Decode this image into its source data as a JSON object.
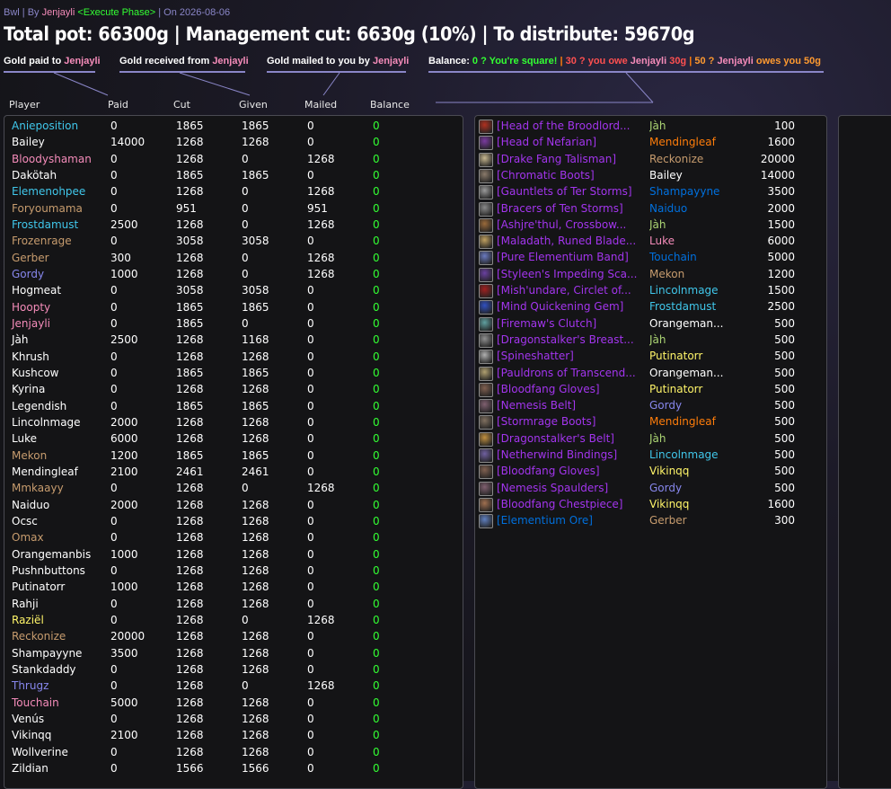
{
  "colors": {
    "druid": "#ff7d0a",
    "hunter": "#abd473",
    "mage": "#40c7eb",
    "paladin": "#f58cba",
    "priest": "#ffffff",
    "rogue": "#fff569",
    "shaman": "#0070de",
    "warlock": "#8787ed",
    "warrior": "#c79c6e",
    "epic": "#a335ee",
    "rare": "#0070dd",
    "zero": "#33ff33",
    "muted": "#8a86c8"
  },
  "topbar": {
    "raid": "Bwl",
    "sep1": " | By ",
    "author": "Jenjayli",
    "phase": " <Execute Phase>",
    "sep2": " | On 2026-08-06"
  },
  "title": "Total pot: 66300g | Management cut: 6630g (10%) | To distribute: 59670g",
  "legend": {
    "paid_prefix": "Gold paid to ",
    "paid_name": "Jenjayli",
    "received_prefix": "Gold received from ",
    "received_name": "Jenjayli",
    "mailed_prefix": "Gold mailed to you by ",
    "mailed_name": "Jenjayli",
    "balance_label": "Balance: ",
    "bal_zero": "0 ? You're square!",
    "bal_sep1": " | ",
    "bal_neg_prefix": "30 ? you owe ",
    "bal_neg_name": "Jenjayli",
    "bal_neg_suffix": " 30g",
    "bal_sep2": " | ",
    "bal_pos_prefix": "50 ? ",
    "bal_pos_name": "Jenjayli",
    "bal_pos_suffix": " owes you 50g"
  },
  "columns": {
    "player": "Player",
    "paid": "Paid",
    "cut": "Cut",
    "given": "Given",
    "mailed": "Mailed",
    "balance": "Balance"
  },
  "players": [
    {
      "name": "Anieposition",
      "cls": "mage",
      "paid": "0",
      "cut": "1865",
      "given": "1865",
      "mailed": "0",
      "balance": "0"
    },
    {
      "name": "Bailey",
      "cls": "priest",
      "paid": "14000",
      "cut": "1268",
      "given": "1268",
      "mailed": "0",
      "balance": "0"
    },
    {
      "name": "Bloodyshaman",
      "cls": "paladin",
      "paid": "0",
      "cut": "1268",
      "given": "0",
      "mailed": "1268",
      "balance": "0"
    },
    {
      "name": "Dakötah",
      "cls": "priest",
      "paid": "0",
      "cut": "1865",
      "given": "1865",
      "mailed": "0",
      "balance": "0"
    },
    {
      "name": "Elemenohpee",
      "cls": "mage",
      "paid": "0",
      "cut": "1268",
      "given": "0",
      "mailed": "1268",
      "balance": "0"
    },
    {
      "name": "Foryoumama",
      "cls": "warrior",
      "paid": "0",
      "cut": "951",
      "given": "0",
      "mailed": "951",
      "balance": "0"
    },
    {
      "name": "Frostdamust",
      "cls": "mage",
      "paid": "2500",
      "cut": "1268",
      "given": "0",
      "mailed": "1268",
      "balance": "0"
    },
    {
      "name": "Frozenrage",
      "cls": "warrior",
      "paid": "0",
      "cut": "3058",
      "given": "3058",
      "mailed": "0",
      "balance": "0"
    },
    {
      "name": "Gerber",
      "cls": "warrior",
      "paid": "300",
      "cut": "1268",
      "given": "0",
      "mailed": "1268",
      "balance": "0"
    },
    {
      "name": "Gordy",
      "cls": "warlock",
      "paid": "1000",
      "cut": "1268",
      "given": "0",
      "mailed": "1268",
      "balance": "0"
    },
    {
      "name": "Hogmeat",
      "cls": "priest",
      "paid": "0",
      "cut": "3058",
      "given": "3058",
      "mailed": "0",
      "balance": "0"
    },
    {
      "name": "Hoopty",
      "cls": "paladin",
      "paid": "0",
      "cut": "1865",
      "given": "1865",
      "mailed": "0",
      "balance": "0"
    },
    {
      "name": "Jenjayli",
      "cls": "paladin",
      "paid": "0",
      "cut": "1865",
      "given": "0",
      "mailed": "0",
      "balance": "0"
    },
    {
      "name": "Jàh",
      "cls": "priest",
      "paid": "2500",
      "cut": "1268",
      "given": "1168",
      "mailed": "0",
      "balance": "0"
    },
    {
      "name": "Khrush",
      "cls": "priest",
      "paid": "0",
      "cut": "1268",
      "given": "1268",
      "mailed": "0",
      "balance": "0"
    },
    {
      "name": "Kushcow",
      "cls": "priest",
      "paid": "0",
      "cut": "1865",
      "given": "1865",
      "mailed": "0",
      "balance": "0"
    },
    {
      "name": "Kyrina",
      "cls": "priest",
      "paid": "0",
      "cut": "1268",
      "given": "1268",
      "mailed": "0",
      "balance": "0"
    },
    {
      "name": "Legendish",
      "cls": "priest",
      "paid": "0",
      "cut": "1865",
      "given": "1865",
      "mailed": "0",
      "balance": "0"
    },
    {
      "name": "Lincolnmage",
      "cls": "priest",
      "paid": "2000",
      "cut": "1268",
      "given": "1268",
      "mailed": "0",
      "balance": "0"
    },
    {
      "name": "Luke",
      "cls": "priest",
      "paid": "6000",
      "cut": "1268",
      "given": "1268",
      "mailed": "0",
      "balance": "0"
    },
    {
      "name": "Mekon",
      "cls": "warrior",
      "paid": "1200",
      "cut": "1865",
      "given": "1865",
      "mailed": "0",
      "balance": "0"
    },
    {
      "name": "Mendingleaf",
      "cls": "priest",
      "paid": "2100",
      "cut": "2461",
      "given": "2461",
      "mailed": "0",
      "balance": "0"
    },
    {
      "name": "Mmkaayy",
      "cls": "warrior",
      "paid": "0",
      "cut": "1268",
      "given": "0",
      "mailed": "1268",
      "balance": "0"
    },
    {
      "name": "Naiduo",
      "cls": "priest",
      "paid": "2000",
      "cut": "1268",
      "given": "1268",
      "mailed": "0",
      "balance": "0"
    },
    {
      "name": "Ocsc",
      "cls": "priest",
      "paid": "0",
      "cut": "1268",
      "given": "1268",
      "mailed": "0",
      "balance": "0"
    },
    {
      "name": "Omax",
      "cls": "warrior",
      "paid": "0",
      "cut": "1268",
      "given": "1268",
      "mailed": "0",
      "balance": "0"
    },
    {
      "name": "Orangemanbis",
      "cls": "priest",
      "paid": "1000",
      "cut": "1268",
      "given": "1268",
      "mailed": "0",
      "balance": "0"
    },
    {
      "name": "Pushnbuttons",
      "cls": "priest",
      "paid": "0",
      "cut": "1268",
      "given": "1268",
      "mailed": "0",
      "balance": "0"
    },
    {
      "name": "Putinatorr",
      "cls": "priest",
      "paid": "1000",
      "cut": "1268",
      "given": "1268",
      "mailed": "0",
      "balance": "0"
    },
    {
      "name": "Rahji",
      "cls": "priest",
      "paid": "0",
      "cut": "1268",
      "given": "1268",
      "mailed": "0",
      "balance": "0"
    },
    {
      "name": "Raziël",
      "cls": "rogue",
      "paid": "0",
      "cut": "1268",
      "given": "0",
      "mailed": "1268",
      "balance": "0"
    },
    {
      "name": "Reckonize",
      "cls": "warrior",
      "paid": "20000",
      "cut": "1268",
      "given": "1268",
      "mailed": "0",
      "balance": "0"
    },
    {
      "name": "Shampayyne",
      "cls": "priest",
      "paid": "3500",
      "cut": "1268",
      "given": "1268",
      "mailed": "0",
      "balance": "0"
    },
    {
      "name": "Stankdaddy",
      "cls": "priest",
      "paid": "0",
      "cut": "1268",
      "given": "1268",
      "mailed": "0",
      "balance": "0"
    },
    {
      "name": "Thrugz",
      "cls": "warlock",
      "paid": "0",
      "cut": "1268",
      "given": "0",
      "mailed": "1268",
      "balance": "0"
    },
    {
      "name": "Touchain",
      "cls": "paladin",
      "paid": "5000",
      "cut": "1268",
      "given": "1268",
      "mailed": "0",
      "balance": "0"
    },
    {
      "name": "Venús",
      "cls": "priest",
      "paid": "0",
      "cut": "1268",
      "given": "1268",
      "mailed": "0",
      "balance": "0"
    },
    {
      "name": "Vikinqq",
      "cls": "priest",
      "paid": "2100",
      "cut": "1268",
      "given": "1268",
      "mailed": "0",
      "balance": "0"
    },
    {
      "name": "Wollverine",
      "cls": "priest",
      "paid": "0",
      "cut": "1268",
      "given": "1268",
      "mailed": "0",
      "balance": "0"
    },
    {
      "name": "Zildian",
      "cls": "priest",
      "paid": "0",
      "cut": "1566",
      "given": "1566",
      "mailed": "0",
      "balance": "0"
    }
  ],
  "loot": [
    {
      "item": "[Head of the Broodlord...",
      "icon": "skull-icon",
      "icon_color": "#b03020",
      "looter": "Jàh",
      "cls": "hunter",
      "amount": "100"
    },
    {
      "item": "[Head of Nefarian]",
      "icon": "skull-icon",
      "icon_color": "#7a3aa0",
      "looter": "Mendingleaf",
      "cls": "druid",
      "amount": "1600"
    },
    {
      "item": "[Drake Fang Talisman]",
      "icon": "fang-icon",
      "icon_color": "#c8b890",
      "looter": "Reckonize",
      "cls": "warrior",
      "amount": "20000"
    },
    {
      "item": "[Chromatic Boots]",
      "icon": "boots-icon",
      "icon_color": "#8a7a6a",
      "looter": "Bailey",
      "cls": "priest",
      "amount": "14000"
    },
    {
      "item": "[Gauntlets of Ter Storms]",
      "icon": "gauntlets-icon",
      "icon_color": "#9a9a9a",
      "looter": "Shampayyne",
      "cls": "shaman",
      "amount": "3500"
    },
    {
      "item": "[Bracers of Ten Storms]",
      "icon": "bracers-icon",
      "icon_color": "#8a8a8a",
      "looter": "Naiduo",
      "cls": "shaman",
      "amount": "2000"
    },
    {
      "item": "[Ashjre'thul, Crossbow...",
      "icon": "crossbow-icon",
      "icon_color": "#9a6a3a",
      "looter": "Jàh",
      "cls": "hunter",
      "amount": "1500"
    },
    {
      "item": "[Maladath, Runed Blade...",
      "icon": "sword-icon",
      "icon_color": "#c0a060",
      "looter": "Luke",
      "cls": "paladin",
      "amount": "6000"
    },
    {
      "item": "[Pure Elementium Band]",
      "icon": "ring-icon",
      "icon_color": "#6a7ac0",
      "looter": "Touchain",
      "cls": "shaman",
      "amount": "5000"
    },
    {
      "item": "[Styleen's Impeding Sca...",
      "icon": "scarab-icon",
      "icon_color": "#6a40a0",
      "looter": "Mekon",
      "cls": "warrior",
      "amount": "1200"
    },
    {
      "item": "[Mish'undare, Circlet of...",
      "icon": "circlet-icon",
      "icon_color": "#a02020",
      "looter": "Lincolnmage",
      "cls": "mage",
      "amount": "1500"
    },
    {
      "item": "[Mind Quickening Gem]",
      "icon": "gem-icon",
      "icon_color": "#3050c0",
      "looter": "Frostdamust",
      "cls": "mage",
      "amount": "2500"
    },
    {
      "item": "[Firemaw's Clutch]",
      "icon": "belt-icon",
      "icon_color": "#60a0a0",
      "looter": "Orangeman...",
      "cls": "priest",
      "amount": "500"
    },
    {
      "item": "[Dragonstalker's Breast...",
      "icon": "chest-icon",
      "icon_color": "#909090",
      "looter": "Jàh",
      "cls": "hunter",
      "amount": "500"
    },
    {
      "item": "[Spineshatter]",
      "icon": "mace-icon",
      "icon_color": "#b0b0b0",
      "looter": "Putinatorr",
      "cls": "rogue",
      "amount": "500"
    },
    {
      "item": "[Pauldrons of Transcend...",
      "icon": "shoulder-icon",
      "icon_color": "#b0a070",
      "looter": "Orangeman...",
      "cls": "priest",
      "amount": "500"
    },
    {
      "item": "[Bloodfang Gloves]",
      "icon": "gloves-icon",
      "icon_color": "#806050",
      "looter": "Putinatorr",
      "cls": "rogue",
      "amount": "500"
    },
    {
      "item": "[Nemesis Belt]",
      "icon": "belt-icon",
      "icon_color": "#806070",
      "looter": "Gordy",
      "cls": "warlock",
      "amount": "500"
    },
    {
      "item": "[Stormrage Boots]",
      "icon": "boots-icon",
      "icon_color": "#807060",
      "looter": "Mendingleaf",
      "cls": "druid",
      "amount": "500"
    },
    {
      "item": "[Dragonstalker's Belt]",
      "icon": "belt-icon",
      "icon_color": "#c09040",
      "looter": "Jàh",
      "cls": "hunter",
      "amount": "500"
    },
    {
      "item": "[Netherwind Bindings]",
      "icon": "bracers-icon",
      "icon_color": "#7060a0",
      "looter": "Lincolnmage",
      "cls": "mage",
      "amount": "500"
    },
    {
      "item": "[Bloodfang Gloves]",
      "icon": "gloves-icon",
      "icon_color": "#806050",
      "looter": "Vikinqq",
      "cls": "rogue",
      "amount": "500"
    },
    {
      "item": "[Nemesis Spaulders]",
      "icon": "shoulder-icon",
      "icon_color": "#806070",
      "looter": "Gordy",
      "cls": "warlock",
      "amount": "500"
    },
    {
      "item": "[Bloodfang Chestpiece]",
      "icon": "chest-icon",
      "icon_color": "#a07050",
      "looter": "Vikinqq",
      "cls": "rogue",
      "amount": "1600"
    },
    {
      "item": "[Elementium Ore]",
      "icon": "ore-icon",
      "icon_color": "#6080c0",
      "looter": "Gerber",
      "cls": "warrior",
      "amount": "300",
      "item_cls": "rare"
    }
  ]
}
